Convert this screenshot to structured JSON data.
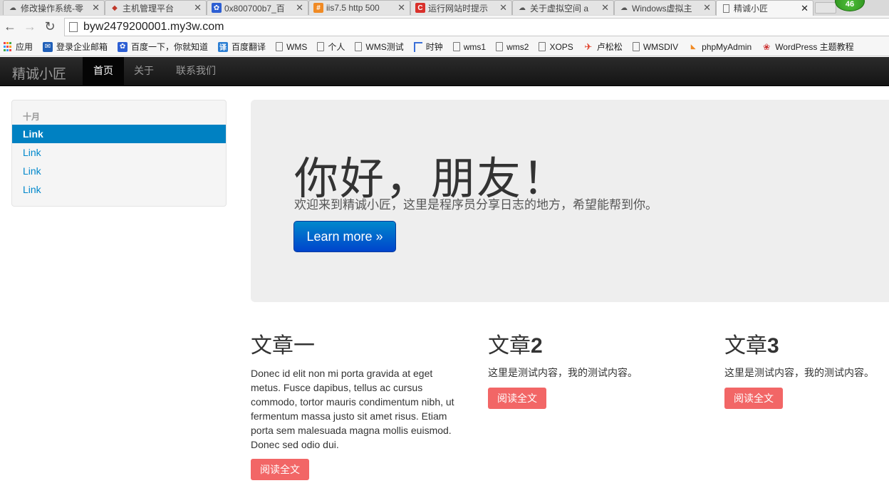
{
  "browser": {
    "tabs": [
      {
        "label": "修改操作系统-零",
        "icon": "cloud-icon",
        "color": "#555555"
      },
      {
        "label": "主机管理平台",
        "icon": "diamond-icon",
        "color": "#c0392b"
      },
      {
        "label": "0x800700b7_百",
        "icon": "paw-icon",
        "color": "#2d5fd3"
      },
      {
        "label": "iis7.5 http 500",
        "icon": "grid-icon",
        "color": "#f08a24"
      },
      {
        "label": "运行网站时提示",
        "icon": "c-icon",
        "color": "#d9302b"
      },
      {
        "label": "关于虚拟空间 a",
        "icon": "cloud-icon",
        "color": "#555555"
      },
      {
        "label": "Windows虚拟主",
        "icon": "cloud-icon",
        "color": "#555555"
      },
      {
        "label": "精诚小匠",
        "icon": "page-icon",
        "color": "#666666"
      }
    ],
    "extension_badge": "46",
    "url": "byw2479200001.my3w.com",
    "bookmarks": [
      {
        "label": "应用",
        "icon": "apps-icon"
      },
      {
        "label": "登录企业邮箱",
        "icon": "mail-icon"
      },
      {
        "label": "百度一下，你就知道",
        "icon": "paw-icon"
      },
      {
        "label": "百度翻译",
        "icon": "translate-icon"
      },
      {
        "label": "WMS",
        "icon": "page-icon"
      },
      {
        "label": "个人",
        "icon": "page-icon"
      },
      {
        "label": "WMS测试",
        "icon": "page-icon"
      },
      {
        "label": "时钟",
        "icon": "bracket-icon"
      },
      {
        "label": "wms1",
        "icon": "page-icon"
      },
      {
        "label": "wms2",
        "icon": "page-icon"
      },
      {
        "label": "XOPS",
        "icon": "page-icon"
      },
      {
        "label": "卢松松",
        "icon": "bird-icon"
      },
      {
        "label": "WMSDIV",
        "icon": "page-icon"
      },
      {
        "label": "phpMyAdmin",
        "icon": "pma-icon"
      },
      {
        "label": "WordPress 主题教程",
        "icon": "wp-icon"
      }
    ]
  },
  "site": {
    "brand": "精诚小匠",
    "nav": [
      {
        "label": "首页",
        "active": true
      },
      {
        "label": "关于",
        "active": false
      },
      {
        "label": "联系我们",
        "active": false
      }
    ],
    "sidebar": {
      "header": "十月",
      "links": [
        {
          "label": "Link",
          "active": true
        },
        {
          "label": "Link",
          "active": false
        },
        {
          "label": "Link",
          "active": false
        },
        {
          "label": "Link",
          "active": false
        }
      ]
    },
    "hero": {
      "title": "你好，朋友！",
      "subtitle": "欢迎来到精诚小匠，这里是程序员分享日志的地方，希望能帮到你。",
      "button": "Learn more »"
    },
    "articles": [
      {
        "title": "文章一",
        "title_num": "",
        "body": "Donec id elit non mi porta gravida at eget metus. Fusce dapibus, tellus ac cursus commodo, tortor mauris condimentum nibh, ut fermentum massa justo sit amet risus. Etiam porta sem malesuada magna mollis euismod. Donec sed odio dui.",
        "button": "阅读全文"
      },
      {
        "title": "文章",
        "title_num": "2",
        "body": "这里是测试内容，我的测试内容。",
        "button": "阅读全文"
      },
      {
        "title": "文章",
        "title_num": "3",
        "body": "这里是测试内容，我的测试内容。",
        "button": "阅读全文"
      }
    ]
  },
  "colors": {
    "navbar": "#1b1b1b",
    "sidebar_active": "#0081c2",
    "link": "#0088cc",
    "hero_bg": "#eeeeee",
    "primary_button": "#0055cc",
    "read_button": "#f26666"
  }
}
